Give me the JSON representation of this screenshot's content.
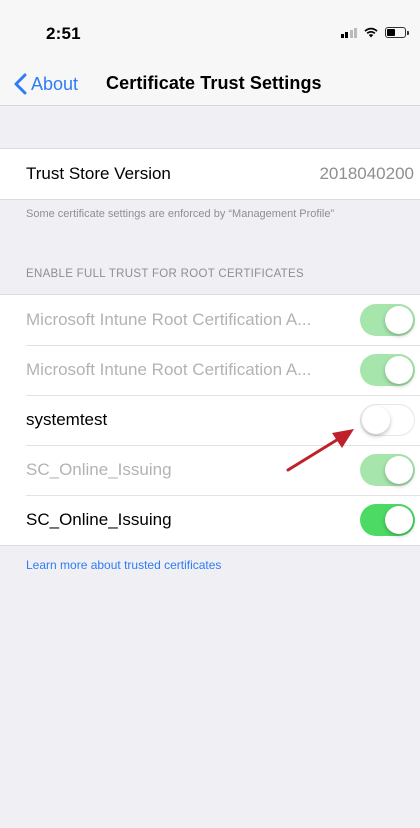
{
  "status_bar": {
    "time": "2:51",
    "icons": [
      "cellular-signal-icon",
      "wifi-icon",
      "battery-icon"
    ]
  },
  "nav": {
    "back_label": "About",
    "title": "Certificate Trust Settings"
  },
  "trust_store": {
    "label": "Trust Store Version",
    "value": "2018040200"
  },
  "managed_note": "Some certificate settings are enforced by “Management Profile”",
  "section_header": "ENABLE FULL TRUST FOR ROOT CERTIFICATES",
  "certificates": [
    {
      "label": "Microsoft Intune Root Certification A...",
      "enabled": true,
      "managed": true
    },
    {
      "label": "Microsoft Intune Root Certification A...",
      "enabled": true,
      "managed": true
    },
    {
      "label": "systemtest",
      "enabled": false,
      "managed": false
    },
    {
      "label": "SC_Online_Issuing",
      "enabled": true,
      "managed": true
    },
    {
      "label": "SC_Online_Issuing",
      "enabled": true,
      "managed": false
    }
  ],
  "learn_more_link": "Learn more about trusted certificates",
  "colors": {
    "accent": "#2f7cf6",
    "toggle_on": "#4cd964",
    "toggle_managed": "#a6e6ad",
    "annotation_arrow": "#c0202a",
    "background": "#efeff4"
  }
}
